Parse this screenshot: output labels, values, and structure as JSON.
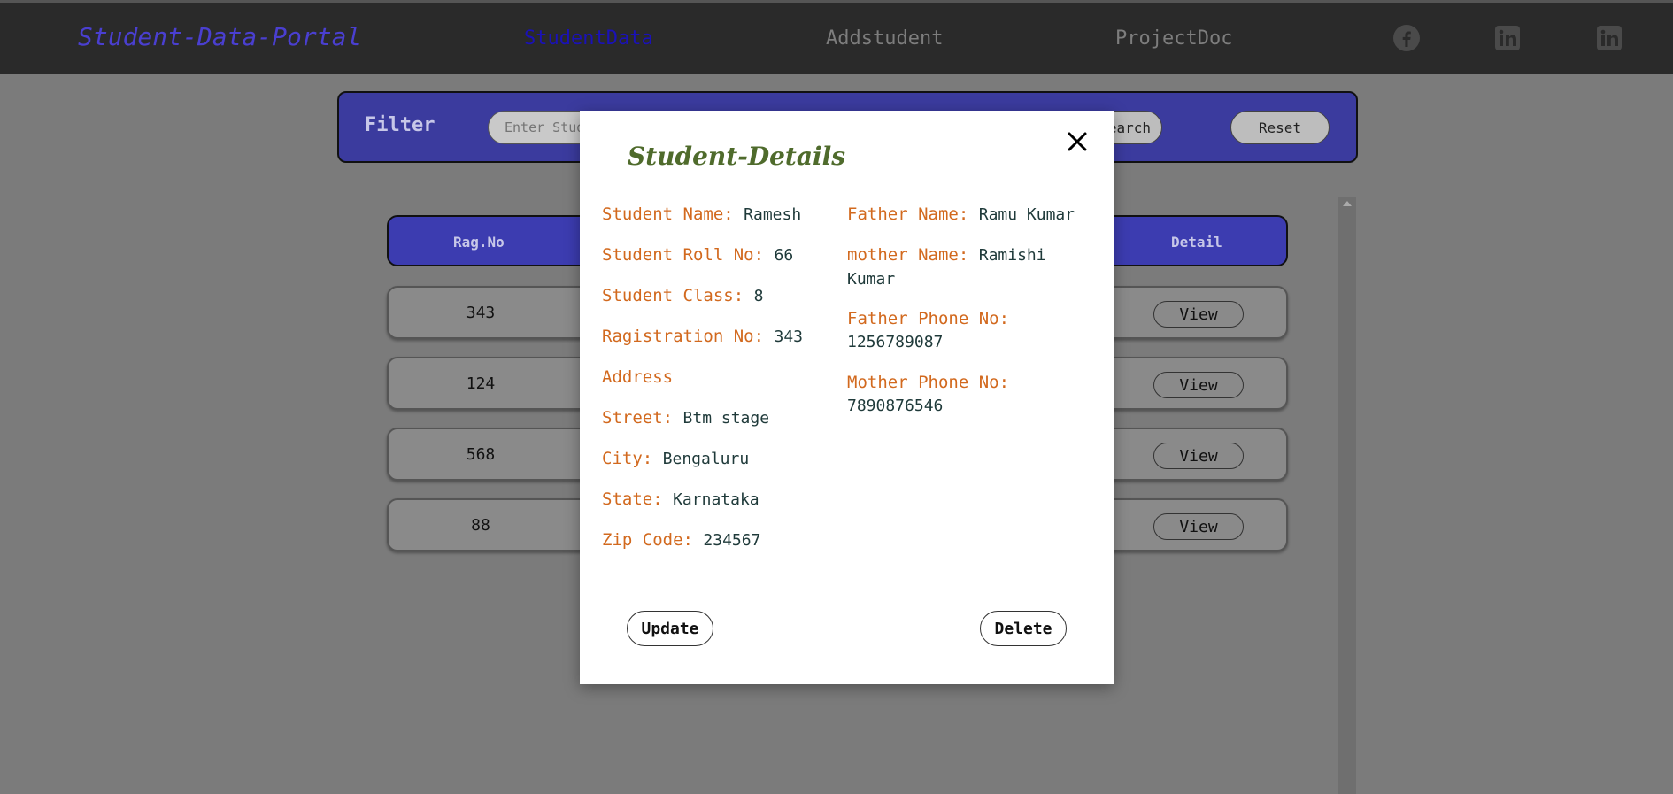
{
  "nav": {
    "brand": "Student-Data-Portal",
    "links": [
      "StudentData",
      "Addstudent",
      "ProjectDoc"
    ]
  },
  "filter": {
    "label": "Filter",
    "name_placeholder": "Enter Student",
    "search_label": "Search",
    "reset_label": "Reset"
  },
  "table": {
    "headers": {
      "reg": "Rag.No",
      "detail": "Detail"
    },
    "rows": [
      {
        "reg": "343",
        "action": "View"
      },
      {
        "reg": "124",
        "action": "View"
      },
      {
        "reg": "568",
        "action": "View"
      },
      {
        "reg": "88",
        "action": "View"
      }
    ]
  },
  "modal": {
    "title": "Student-Details",
    "student_name_label": "Student Name:",
    "student_name": "Ramesh",
    "roll_label": "Student Roll No:",
    "roll": "66",
    "class_label": "Student Class:",
    "class": "8",
    "reg_label": "Ragistration No:",
    "reg": "343",
    "address_label": "Address",
    "street_label": "Street:",
    "street": "Btm stage",
    "city_label": "City:",
    "city": "Bengaluru",
    "state_label": "State:",
    "state": "Karnataka",
    "zip_label": "Zip Code:",
    "zip": "234567",
    "father_name_label": "Father Name:",
    "father_name": "Ramu Kumar",
    "mother_name_label": "mother Name:",
    "mother_name": "Ramishi Kumar",
    "father_phone_label": "Father Phone No:",
    "father_phone": "1256789087",
    "mother_phone_label": "Mother Phone No:",
    "mother_phone": "7890876546",
    "update_label": "Update",
    "delete_label": "Delete"
  },
  "icons": {
    "facebook": "facebook-icon",
    "linkedin": "linkedin-icon",
    "close": "close-icon"
  },
  "colors": {
    "navbar_bg": "#2a2a2a",
    "brand": "#4a3fd0",
    "active_link": "#1a11b8",
    "accent_blue": "#3b3b9e",
    "modal_label": "#d2691e",
    "modal_title": "#4f6b2c"
  }
}
